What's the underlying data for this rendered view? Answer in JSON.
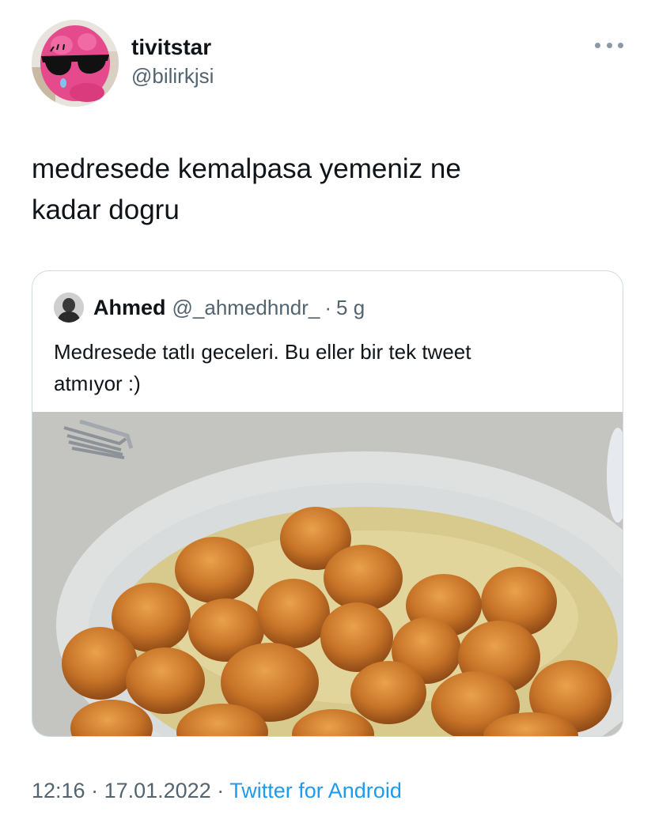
{
  "author": {
    "display_name": "tivitstar",
    "handle": "@bilirkjsi",
    "avatar_icon": "pink-plush-sunglasses-avatar"
  },
  "tweet": {
    "line1": "medresede kemalpasa yemeniz ne",
    "line2": "kadar dogru"
  },
  "quoted": {
    "display_name": "Ahmed",
    "handle": "@_ahmedhndr_",
    "separator": "·",
    "age": "5 g",
    "line1": "Medresede tatlı geceleri. Bu eller bir tek tweet",
    "line2": "atmıyor :)",
    "media_icon": "dessert-plate-photo"
  },
  "footer": {
    "time": "12:16",
    "sep1": " · ",
    "date": "17.01.2022",
    "sep2": " · ",
    "source": "Twitter for Android"
  },
  "colors": {
    "accent": "#1d9bf0",
    "secondary_text": "#536471",
    "border": "#cfd9de"
  }
}
